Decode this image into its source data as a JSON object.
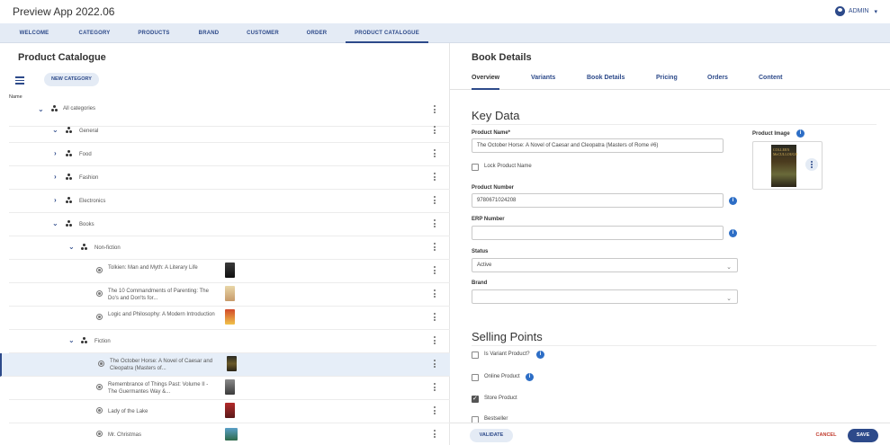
{
  "app": {
    "title": "Preview App 2022.06",
    "user": "ADMIN",
    "user_caret": "▾"
  },
  "nav": [
    {
      "label": "WELCOME"
    },
    {
      "label": "CATEGORY"
    },
    {
      "label": "PRODUCTS"
    },
    {
      "label": "BRAND"
    },
    {
      "label": "CUSTOMER"
    },
    {
      "label": "ORDER"
    },
    {
      "label": "PRODUCT CATALOGUE",
      "active": true
    }
  ],
  "left": {
    "title": "Product Catalogue",
    "new_category_label": "NEW CATEGORY",
    "name_column": "Name",
    "tree": [
      {
        "type": "category",
        "label": "All categories",
        "chevron": "⌄"
      },
      {
        "type": "category",
        "label": "General",
        "chevron": "⌄"
      },
      {
        "type": "category",
        "label": "Food",
        "chevron": "›"
      },
      {
        "type": "category",
        "label": "Fashion",
        "chevron": "›"
      },
      {
        "type": "category",
        "label": "Electronics",
        "chevron": "›"
      },
      {
        "type": "category",
        "label": "Books",
        "chevron": "⌄"
      },
      {
        "type": "category",
        "label": "Non-fiction",
        "chevron": "⌄"
      },
      {
        "type": "product",
        "label": "Tolkien: Man and Myth: A Literary Life"
      },
      {
        "type": "product",
        "label": "The 10 Commandments of Parenting: The Do's and Don'ts for..."
      },
      {
        "type": "product",
        "label": "Logic and Philosophy: A Modern Introduction"
      },
      {
        "type": "category",
        "label": "Fiction",
        "chevron": "⌄"
      },
      {
        "type": "product",
        "label": "The October Horse: A Novel of Caesar and Cleopatra (Masters of..."
      },
      {
        "type": "product",
        "label": "Remembrance of Things Past: Volume II - The Guermantes Way &..."
      },
      {
        "type": "product",
        "label": "Lady of the Lake"
      },
      {
        "type": "product",
        "label": "Mr. Christmas"
      }
    ]
  },
  "right": {
    "title": "Book Details",
    "tabs": [
      {
        "label": "Overview",
        "active": true
      },
      {
        "label": "Variants"
      },
      {
        "label": "Book Details"
      },
      {
        "label": "Pricing"
      },
      {
        "label": "Orders"
      },
      {
        "label": "Content"
      }
    ],
    "key_data": {
      "heading": "Key Data",
      "product_name_label": "Product Name*",
      "product_name_value": "The October Horse: A Novel of Caesar and Cleopatra (Masters of Rome #6)",
      "lock_label": "Lock Product Name",
      "product_number_label": "Product Number",
      "product_number_value": "9780671024208",
      "erp_label": "ERP Number",
      "erp_value": "",
      "status_label": "Status",
      "status_value": "Active",
      "brand_label": "Brand",
      "brand_value": "",
      "product_image_label": "Product Image",
      "product_image_text": "COLLEEN McCULLOUGH"
    },
    "selling_points": {
      "heading": "Selling Points",
      "items": [
        {
          "label": "Is Variant Product?",
          "checked": false
        },
        {
          "label": "Online Product",
          "checked": false
        },
        {
          "label": "Store Product",
          "checked": true
        },
        {
          "label": "Bestseller",
          "checked": false
        }
      ]
    }
  },
  "footer": {
    "validate": "VALIDATE",
    "cancel": "CANCEL",
    "save": "SAVE"
  },
  "icons": {
    "info": "i",
    "select_caret": "⌄",
    "menu": "menu-icon",
    "kebab": "kebab-icon",
    "category": "category-icon",
    "product": "product-icon"
  },
  "colors": {
    "accent": "#2d4a8a",
    "info": "#2d6ec6",
    "nav_bg": "#e4ebf5",
    "selected_row": "#e6eef8",
    "cancel": "#c0392b"
  }
}
